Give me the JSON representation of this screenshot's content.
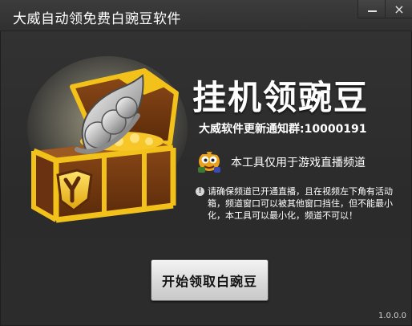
{
  "window": {
    "title": "大威自动领免费白豌豆软件",
    "minimize_symbol": "—",
    "close_symbol": "×"
  },
  "main": {
    "heading": "挂机领豌豆",
    "notice_line": "大威软件更新通知群:10000191",
    "feature_text": "本工具仅用于游戏直播频道",
    "warning_text": "请确保频道已开通直播，且在视频左下角有活动箱，频道窗口可以被其他窗口挡住，但不能最小化，本工具可以最小化，频道不可以！",
    "start_button_label": "开始领取白豌豆",
    "version": "1.0.0.0"
  },
  "icons": {
    "hero": "treasure-chest-with-pea-icon",
    "mascot": "mascot-icon",
    "warning": "info-icon",
    "minimize": "minimize-icon",
    "close": "close-icon"
  },
  "colors": {
    "background": "#2e2e2e",
    "titlebar": "#333333",
    "text": "#ffffff",
    "chest_gold": "#f2c21a",
    "chest_wood": "#7a3d12",
    "button": "#d9d9d9"
  }
}
